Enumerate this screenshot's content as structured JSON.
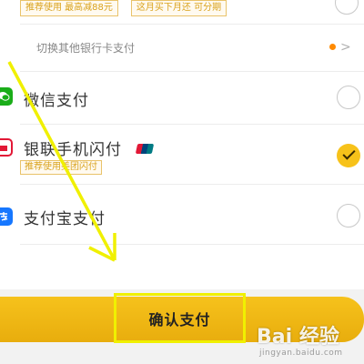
{
  "promo": {
    "tag_1": "推荐使用 最高减88元",
    "tag_2": "这月买下月还 可分期"
  },
  "switch_row": {
    "label": "切换其他银行卡支付",
    "chevron": ">"
  },
  "methods": [
    {
      "label": "微信支付",
      "icon": "wechat-icon",
      "selected": false
    },
    {
      "label": "银联手机闪付",
      "icon": "unionpay-icon",
      "selected": true,
      "tag": "推荐使用美团闪付"
    },
    {
      "label": "支付宝支付",
      "icon": "alipay-icon",
      "selected": false
    }
  ],
  "confirm": {
    "label": "确认支付"
  },
  "watermark": {
    "brand": "Bai 经验",
    "url": "jingyan.baidu.com"
  },
  "colors": {
    "accent": "#f6c21c",
    "highlight_box": "#f0f000",
    "wechat": "#1aad19",
    "unionpay": "#e21836",
    "alipay": "#1677ff"
  }
}
